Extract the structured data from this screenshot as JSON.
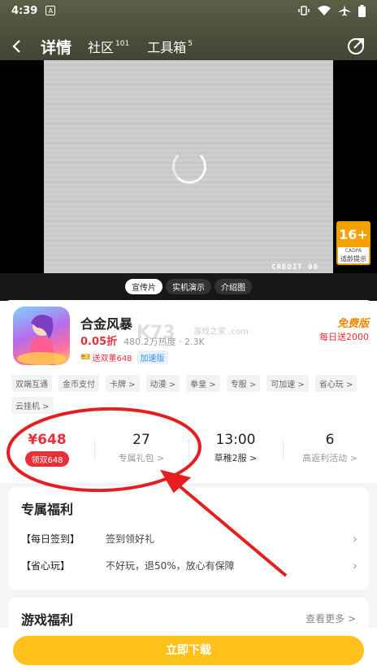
{
  "status_bar": {
    "time": "4:39",
    "a_icon": "A"
  },
  "navbar": {
    "title": "详情",
    "tabs": [
      {
        "label": "社区",
        "count": "101"
      },
      {
        "label": "工具箱",
        "count": "5"
      }
    ]
  },
  "video": {
    "credit_text": "CREDIT  00",
    "age_rating": {
      "value": "16+",
      "sub": "CADPA",
      "tip": "适龄提示"
    }
  },
  "media_tabs": [
    "宣传片",
    "实机演示",
    "介绍图"
  ],
  "game": {
    "name": "合金风暴",
    "discount": "0.05折",
    "meta": "480.2万热度 · 2.3K",
    "gift_tag": "送双董648",
    "speed_tag": "加速版",
    "free_badge": {
      "title": "免费版",
      "subtitle": "每日送2000"
    },
    "watermark": "K73",
    "watermark_sub": "游戏之家 .com"
  },
  "tags": [
    "双端互通",
    "金币支付",
    "卡牌 >",
    "动漫 >",
    "拳皇 >",
    "专服 >",
    "可加速 >",
    "省心玩 >",
    "云挂机 >"
  ],
  "stats": [
    {
      "value": "¥648",
      "pill": "领双648"
    },
    {
      "value": "27",
      "label": "专属礼包 >"
    },
    {
      "value": "13:00",
      "label": "草稚2服 >"
    },
    {
      "value": "6",
      "label": "高返利活动 >"
    }
  ],
  "welfare": {
    "title": "专属福利",
    "rows": [
      {
        "key": "【每日签到】",
        "value": "签到领好礼"
      },
      {
        "key": "【省心玩】",
        "value": "不好玩，退50%，放心有保障"
      }
    ]
  },
  "game_welfare": {
    "title": "游戏福利",
    "more": "查看更多 >"
  },
  "download": {
    "label": "立即下载"
  },
  "colors": {
    "accent": "#ffc21a",
    "price_red": "#e8303a",
    "annotation_red": "#e61e1e"
  }
}
